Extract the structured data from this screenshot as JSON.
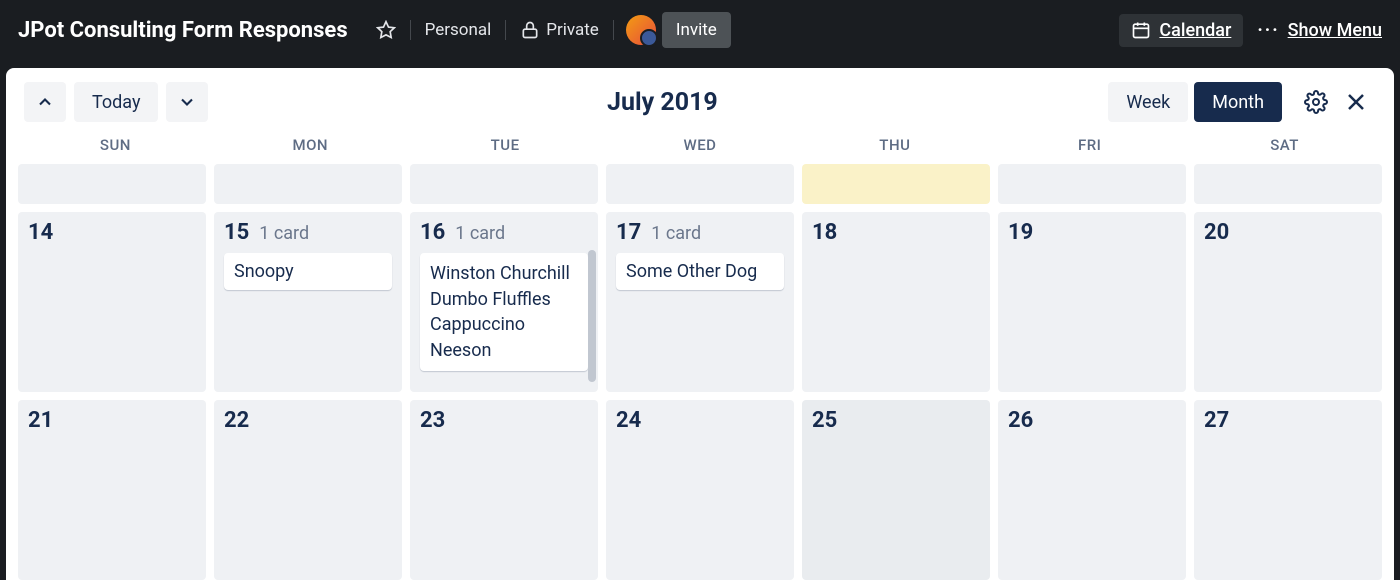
{
  "header": {
    "board_title": "JPot Consulting Form Responses",
    "personal": "Personal",
    "private": "Private",
    "invite": "Invite",
    "calendar_label": "Calendar",
    "show_menu": "Show Menu"
  },
  "toolbar": {
    "today": "Today",
    "month_title": "July 2019",
    "view_week": "Week",
    "view_month": "Month"
  },
  "dow": [
    "SUN",
    "MON",
    "TUE",
    "WED",
    "THU",
    "FRI",
    "SAT"
  ],
  "rows": {
    "r1": {
      "days": [
        {
          "num": "14"
        },
        {
          "num": "15",
          "count": "1 card",
          "cards": [
            "Snoopy"
          ]
        },
        {
          "num": "16",
          "count": "1 card",
          "cards": [
            "Winston Churchill Dumbo Fluffles Cappuccino Neeson"
          ]
        },
        {
          "num": "17",
          "count": "1 card",
          "cards": [
            "Some Other Dog"
          ]
        },
        {
          "num": "18"
        },
        {
          "num": "19"
        },
        {
          "num": "20"
        }
      ]
    },
    "r2": {
      "days": [
        {
          "num": "21"
        },
        {
          "num": "22"
        },
        {
          "num": "23"
        },
        {
          "num": "24"
        },
        {
          "num": "25"
        },
        {
          "num": "26"
        },
        {
          "num": "27"
        }
      ]
    }
  }
}
